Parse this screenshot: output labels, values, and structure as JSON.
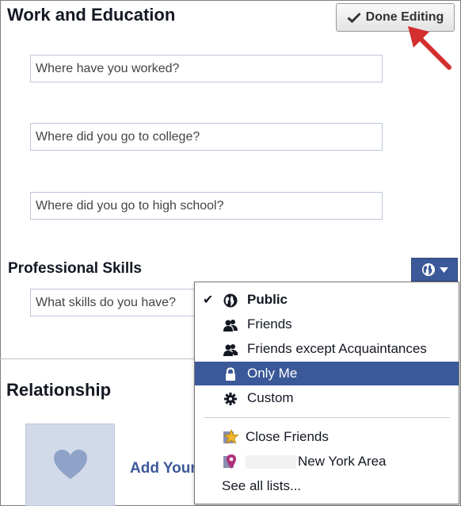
{
  "work_section": {
    "title": "Work and Education",
    "done_button": "Done Editing",
    "work_placeholder": "Where have you worked?",
    "college_placeholder": "Where did you go to college?",
    "highschool_placeholder": "Where did you go to high school?"
  },
  "skills_section": {
    "title": "Professional Skills",
    "placeholder": "What skills do you have?"
  },
  "relationship_section": {
    "title": "Relationship",
    "add_link": "Add Your"
  },
  "privacy_menu": {
    "selected": "Public",
    "items": [
      {
        "label": "Public",
        "icon": "globe-icon",
        "checked": true
      },
      {
        "label": "Friends",
        "icon": "friends-icon"
      },
      {
        "label": "Friends except Acquaintances",
        "icon": "friends-except-icon"
      },
      {
        "label": "Only Me",
        "icon": "lock-icon",
        "highlighted": true
      },
      {
        "label": "Custom",
        "icon": "gear-icon"
      },
      {
        "label": "Close Friends",
        "icon": "star-icon"
      },
      {
        "label": "New York Area",
        "icon": "location-pin-icon"
      },
      {
        "label": "See all lists..."
      }
    ]
  },
  "colors": {
    "accent": "#3b5998",
    "annotation_arrow": "#d32f2f",
    "input_border": "#bdc7d8"
  }
}
